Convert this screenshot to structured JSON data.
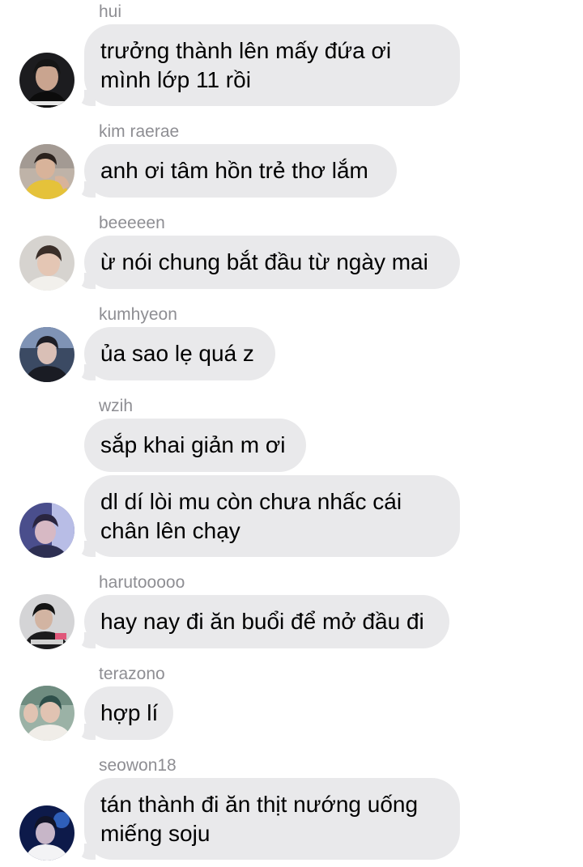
{
  "messages": [
    {
      "sender": "hui",
      "lines": [
        "trưởng thành lên mấy đứa ơi",
        "mình lớp 11 rồi"
      ],
      "avatar_icon": "profile-photo-icon"
    },
    {
      "sender": "kim raerae",
      "lines": [
        "anh ơi tâm hồn trẻ thơ lắm"
      ],
      "avatar_icon": "profile-photo-icon"
    },
    {
      "sender": "beeeeen",
      "lines": [
        "ừ nói chung bắt đầu từ ngày mai"
      ],
      "avatar_icon": "profile-photo-icon"
    },
    {
      "sender": "kumhyeon",
      "lines": [
        "ủa sao lẹ quá z"
      ],
      "avatar_icon": "profile-photo-icon"
    },
    {
      "sender": "wzih",
      "lines": [
        "sắp khai giản m ơi"
      ]
    },
    {
      "lines": [
        "dl dí lòi mu còn chưa nhấc cái",
        "chân lên chạy"
      ],
      "avatar_icon": "profile-photo-icon"
    },
    {
      "sender": "harutooooo",
      "lines": [
        "hay nay đi ăn buổi để mở đầu đi"
      ],
      "avatar_icon": "profile-photo-icon"
    },
    {
      "sender": "terazono",
      "lines": [
        "hợp lí"
      ],
      "avatar_icon": "profile-photo-icon"
    },
    {
      "sender": "seowon18",
      "lines": [
        "tán thành đi ăn thịt nướng uống",
        "miếng soju"
      ],
      "avatar_icon": "profile-photo-icon"
    }
  ],
  "colors": {
    "bubble": "#e9e9eb",
    "sender_text": "#8e8e93",
    "message_text": "#000000",
    "background": "#ffffff"
  }
}
